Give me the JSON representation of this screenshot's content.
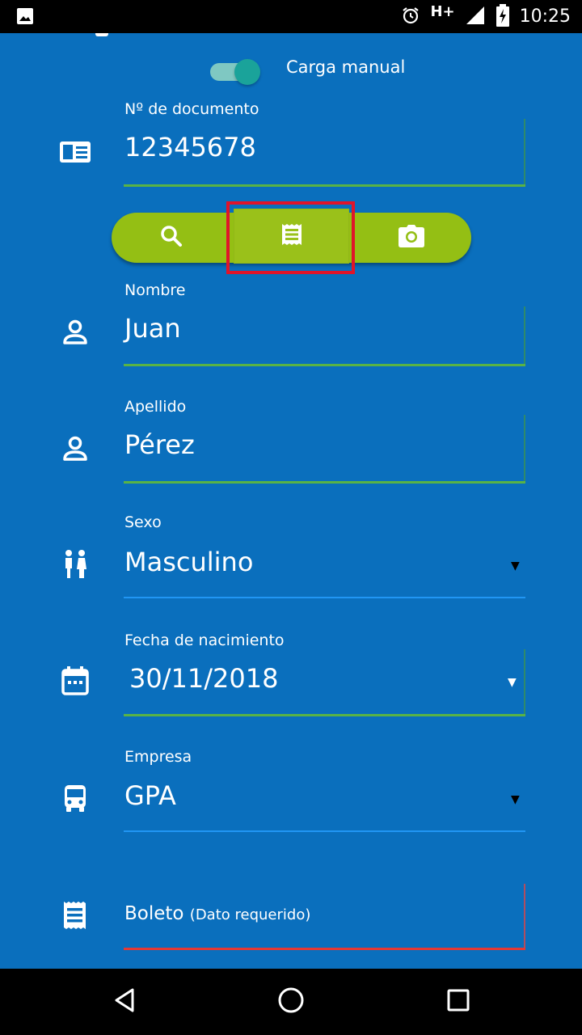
{
  "status_bar": {
    "time": "10:25",
    "network": "H+",
    "icons": [
      "image-icon",
      "alarm-icon",
      "signal-icon",
      "battery-charging-icon"
    ]
  },
  "toggle": {
    "label": "Carga manual",
    "on": true
  },
  "document": {
    "label": "Nº de documento",
    "value": "12345678",
    "icon": "id-card-icon"
  },
  "action_buttons": {
    "icons": [
      "search-icon",
      "receipt-icon",
      "camera-icon"
    ],
    "color": "#94bf14",
    "highlight_color": "#e0142a"
  },
  "nombre": {
    "label": "Nombre",
    "value": "Juan",
    "icon": "person-icon"
  },
  "apellido": {
    "label": "Apellido",
    "value": "Pérez",
    "icon": "person-icon"
  },
  "sexo": {
    "label": "Sexo",
    "value": "Masculino",
    "icon": "people-icon",
    "arrow": "▼"
  },
  "fecha": {
    "label": "Fecha de nacimiento",
    "value": "30/11/2018",
    "icon": "calendar-icon",
    "arrow": "▼"
  },
  "empresa": {
    "label": "Empresa",
    "value": "GPA",
    "icon": "bus-icon",
    "arrow": "▼"
  },
  "boleto": {
    "label": "Boleto",
    "hint": "(Dato requerido)",
    "icon": "receipt-icon"
  },
  "colors": {
    "background": "#0a6fbd",
    "underline_ok": "#59b345",
    "underline_select": "#2196f3",
    "underline_error": "#e53935"
  }
}
